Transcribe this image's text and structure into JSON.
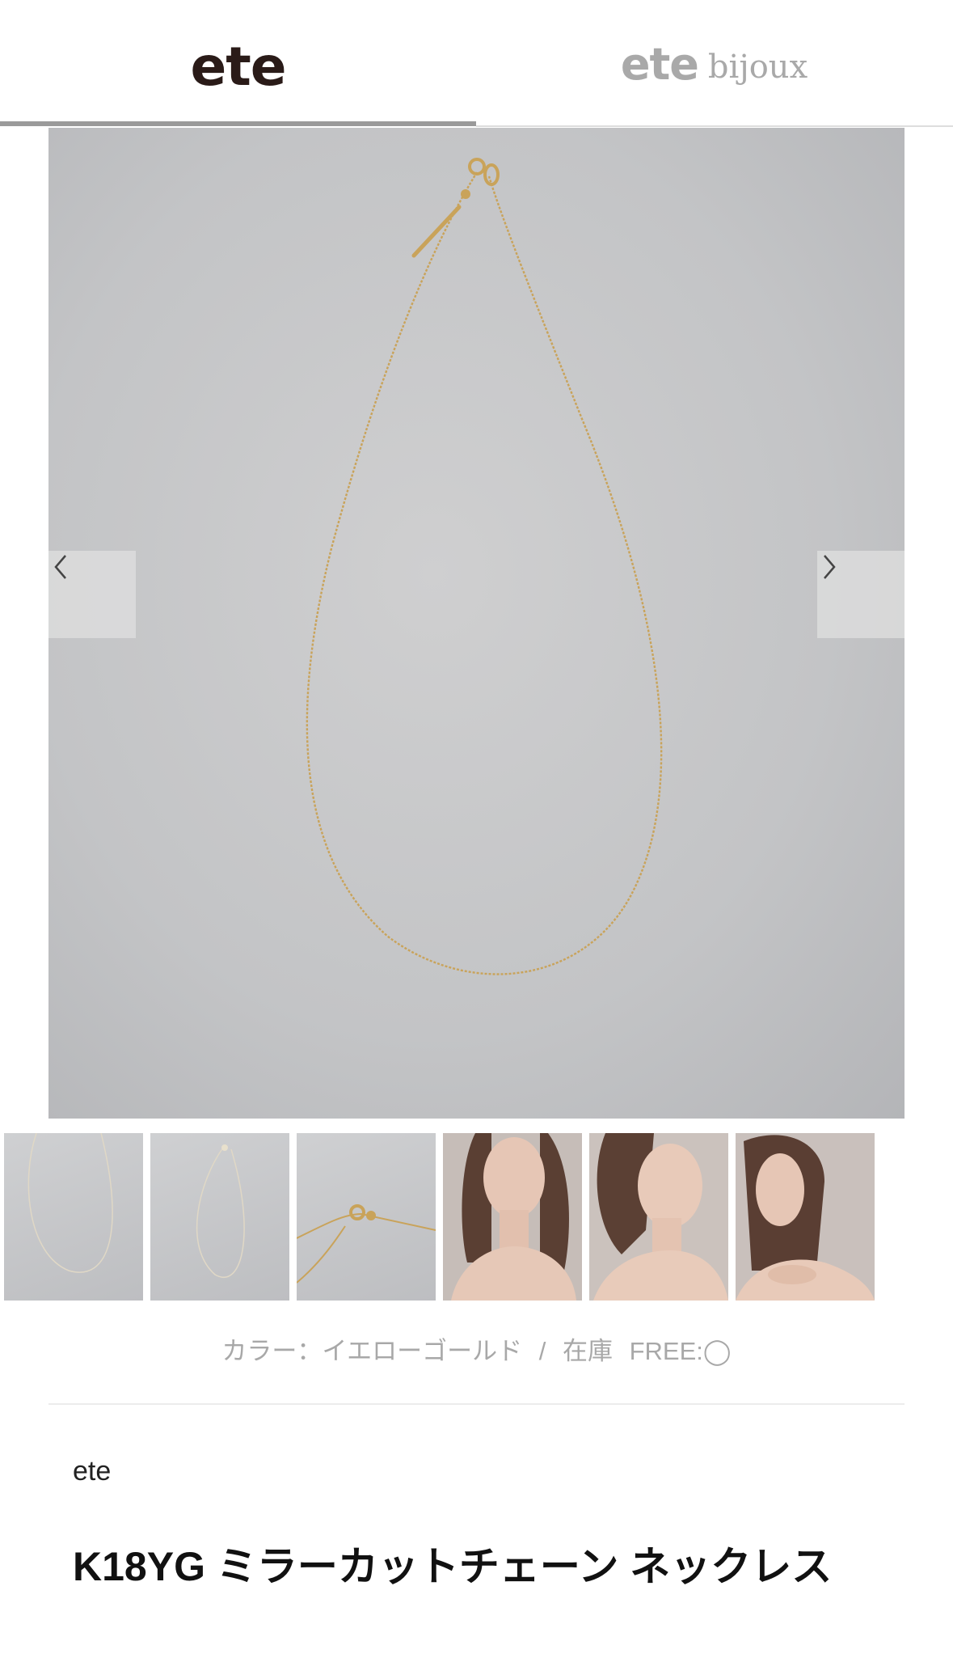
{
  "tabs": {
    "ete_label": "ete",
    "bijoux_ete_label": "ete",
    "bijoux_word": "bijoux",
    "active": "ete"
  },
  "gallery": {
    "prev_icon": "chevron-left-icon",
    "next_icon": "chevron-right-icon",
    "thumbnails": [
      {
        "kind": "product",
        "subject": "full necklace"
      },
      {
        "kind": "product",
        "subject": "necklace angled"
      },
      {
        "kind": "product",
        "subject": "clasp close-up"
      },
      {
        "kind": "model",
        "subject": "model wearing necklace"
      },
      {
        "kind": "model",
        "subject": "model profile"
      },
      {
        "kind": "model",
        "subject": "model side view"
      }
    ]
  },
  "product": {
    "color_label": "カラー：イエローゴールド",
    "separator": "/",
    "stock_label": "在庫",
    "stock_value": "FREE:◯",
    "brand": "ete",
    "title": "K18YG ミラーカットチェーン ネックレス"
  },
  "colors": {
    "logo_active": "#2a1b18",
    "logo_inactive": "#a9a9a9",
    "image_bg": "#c4c5c7",
    "chain_gold": "#c9a35a"
  }
}
